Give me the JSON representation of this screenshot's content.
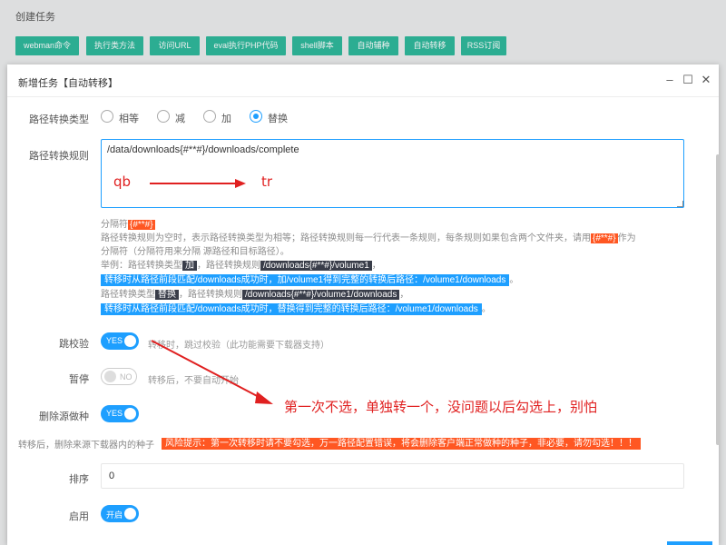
{
  "background": {
    "title": "创建任务",
    "toolbar": [
      "webman命令",
      "执行类方法",
      "访问URL",
      "eval执行PHP代码",
      "shell脚本",
      "自动辅种",
      "自动转移",
      "RSS订阅"
    ]
  },
  "modal": {
    "title": "新增任务【自动转移】",
    "window_buttons": {
      "minimize": "–",
      "maximize": "☐",
      "close": "✕"
    }
  },
  "form": {
    "path_type": {
      "label": "路径转换类型",
      "options": [
        "相等",
        "减",
        "加",
        "替换"
      ],
      "selected": "替换"
    },
    "path_rule": {
      "label": "路径转换规则",
      "value": "/data/downloads{#**#}/downloads/complete"
    },
    "help": {
      "line1_prefix": "分隔符",
      "separator": "{#**#}",
      "line2a": "路径转换规则为空时，表示路径转换类型为相等；路径转换规则每一行代表一条规则，每条规则如果包含两个文件夹，请用",
      "line2b": "作为",
      "line3": "分隔符（分隔符用来分隔 源路径和目标路径）。",
      "example_prefix": "举例：路径转换类型",
      "ex1_type": "加",
      "ex_rule_text": "，路径转换规则",
      "ex1_rule": "/downloads{#**#}/volume1",
      "ex1_result": "转移时从路径前段匹配/downloads成功时，加/volume1得到完整的转换后路径：/volume1/downloads",
      "ex2_prefix": "路径转换类型",
      "ex2_type": "替换",
      "ex2_rule": "/downloads{#**#}/volume1/downloads",
      "ex2_result": "转移时从路径前段匹配/downloads成功时，替换得到完整的转换后路径：/volume1/downloads",
      "period": "。",
      "comma": "，"
    },
    "skip_check": {
      "label": "跳校验",
      "state": "YES",
      "hint": "转移时，跳过校验（此功能需要下载器支持）"
    },
    "pause": {
      "label": "暂停",
      "state": "NO",
      "hint": "转移后，不要自动开始"
    },
    "delete_source": {
      "label": "删除源做种",
      "state": "YES"
    },
    "delete_hint": "转移后，删除来源下载器内的种子",
    "risk_warning": "风险提示：第一次转移时请不要勾选，万一路径配置错误，将会删除客户端正常做种的种子，非必要，请勿勾选！！！",
    "sort": {
      "label": "排序",
      "value": "0"
    },
    "enable": {
      "label": "启用",
      "state": "开启"
    }
  },
  "annotations": {
    "qb": "qb",
    "tr": "tr",
    "note": "第一次不选，单独转一个，没问题以后勾选上，别怕"
  },
  "colors": {
    "accent": "#1e9fff",
    "toolbar": "#2fb89c",
    "danger": "#ff5722",
    "annotation": "#e02020"
  }
}
